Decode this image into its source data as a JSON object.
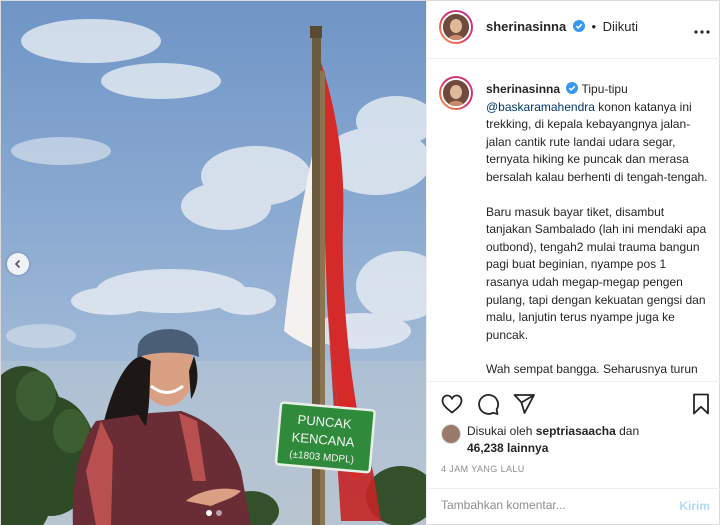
{
  "post": {
    "username": "sherinasinna",
    "follow_dot": "•",
    "follow_status": "Diikuti",
    "caption_intro": "Tipu-tipu",
    "caption_mention": "@baskaramahendra",
    "caption_p1_rest": "konon katanya ini trekking, di kepala kebayangnya jalan-jalan cantik rute landai udara segar, ternyata hiking ke puncak dan merasa bersalah kalau berhenti di tengah-tengah.",
    "caption_p2": "Baru masuk bayar tiket, disambut tanjakan Sambalado (lah ini mendaki apa outbond), tengah2 mulai trauma bangun pagi buat beginian, nyampe pos 1 rasanya udah megap-megap pengen pulang, tapi dengan kekuatan gengsi dan malu, lanjutin terus nyampe juga ke puncak.",
    "caption_p3": "Wah sempat bangga. Seharusnya turun mah mudah dibanding naik kali",
    "liked_by_prefix": "Disukai oleh",
    "liked_by_user": "septriasaacha",
    "liked_by_and": "dan",
    "likes_count": "46,238",
    "likes_suffix": "lainnya",
    "timestamp": "4 JAM YANG LALU",
    "comment_placeholder": "Tambahkan komentar...",
    "post_button": "Kirim"
  },
  "photo": {
    "sign_line1": "PUNCAK",
    "sign_line2": "KENCANA",
    "sign_line3": "(±1803 MDPL)"
  },
  "carousel": {
    "total": 2,
    "active": 1
  },
  "icons": {
    "header_more": "more-horizontal-icon",
    "verified": "verified-badge-icon",
    "prev": "chevron-left-icon",
    "like": "heart-icon",
    "comment": "comment-icon",
    "share": "paper-plane-icon",
    "save": "bookmark-icon"
  },
  "colors": {
    "mention": "#00376b",
    "verified": "#3897f0",
    "post_button_disabled": "#b3dbff",
    "muted": "#8e8e8e",
    "flag_red": "#d42a2a"
  }
}
